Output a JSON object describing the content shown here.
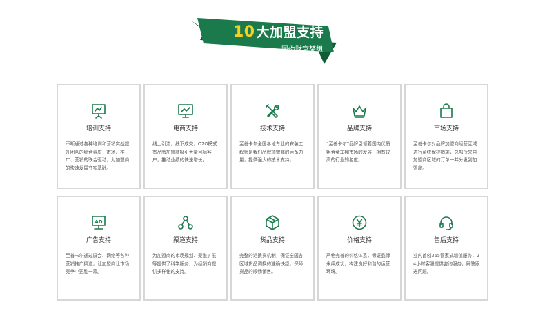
{
  "banner": {
    "number": "10",
    "title": "大加盟支持",
    "subtitle": "圆你财富梦想"
  },
  "colors": {
    "brand_green": "#1a7a4c",
    "accent_yellow": "#f5d020",
    "border": "#d7d7d7"
  },
  "cards": [
    {
      "icon": "presentation-board-icon",
      "title": "培训支持",
      "desc": "不断通过各种培训和营销实战提升团队的综合素质，市场、推广、营销的联合驱动，为加盟商的快速发展夯实基础。"
    },
    {
      "icon": "monitor-chart-icon",
      "title": "电商支持",
      "desc": "线上引流，线下成交，O2O模式有品牌加盟商吸引大量目标客户，推动业绩的快速增长。"
    },
    {
      "icon": "tools-icon",
      "title": "技术支持",
      "desc": "至善卡尔全国各地专业的安装工程师是我们品牌加盟商的后备力量，提供强大的技术支持。"
    },
    {
      "icon": "crown-icon",
      "title": "品牌支持",
      "desc": "“至善卡尔”品牌引领着国内优质铝合金车棚市场的发展，拥有较高的行业知名度。"
    },
    {
      "icon": "shopping-bag-icon",
      "title": "市场支持",
      "desc": "至善卡尔对品牌加盟商经营区域进行系统保护措施，总部所来自加盟商区域的订单一并分发到加盟商。"
    },
    {
      "icon": "ad-sign-icon",
      "title": "广告支持",
      "desc": "至善卡尔通过展会、网络等各种营销推广渠道，让加盟商让市场竞争中更胜一筹。"
    },
    {
      "icon": "network-nodes-icon",
      "title": "渠道支持",
      "desc": "为加盟商的市场规划、渠道扩展等提供了科学服务，为经销商提供多样化的支持。"
    },
    {
      "icon": "package-box-icon",
      "title": "货品支持",
      "desc": "完整的退换货机制，保证全国各区域货品调换的准确快捷，保障货品的顺畅销售。"
    },
    {
      "icon": "yen-coin-icon",
      "title": "价格支持",
      "desc": "严格完善的价格体系，保证品牌永续成功，构建良好和谐的运营环境。"
    },
    {
      "icon": "headset-icon",
      "title": "售后支持",
      "desc": "业内首创365管家式增值服务，24小时客服提供咨询服务，解答跟进问题。"
    }
  ]
}
